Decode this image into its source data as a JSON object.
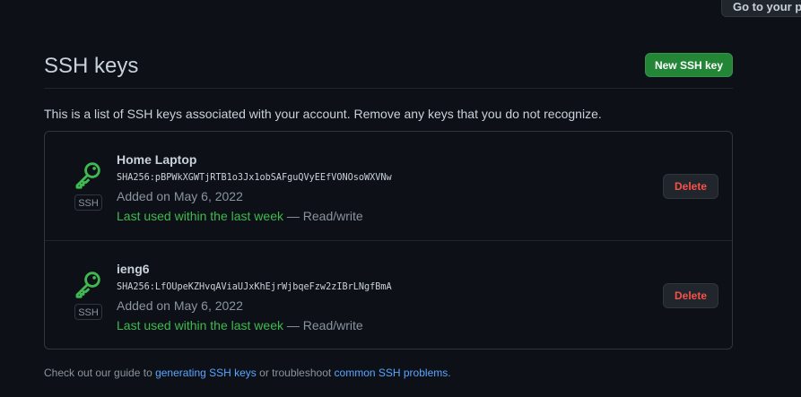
{
  "header": {
    "profile_button_label": "Go to your personal profile"
  },
  "page": {
    "title": "SSH keys",
    "new_key_button_label": "New SSH key",
    "intro": "This is a list of SSH keys associated with your account. Remove any keys that you do not recognize."
  },
  "keys": [
    {
      "name": "Home Laptop",
      "fingerprint": "SHA256:pBPWkXGWTjRTB1o3Jx1obSAFguQVyEEfVONOsoWXVNw",
      "added": "Added on May 6, 2022",
      "last_used": "Last used within the last week",
      "access": " — Read/write",
      "type_badge": "SSH",
      "delete_label": "Delete"
    },
    {
      "name": "ieng6",
      "fingerprint": "SHA256:LfOUpeKZHvqAViaUJxKhEjrWjbqeFzw2zIBrLNgfBmA",
      "added": "Added on May 6, 2022",
      "last_used": "Last used within the last week",
      "access": " — Read/write",
      "type_badge": "SSH",
      "delete_label": "Delete"
    }
  ],
  "footer": {
    "prefix": "Check out our guide to ",
    "link1": "generating SSH keys",
    "middle": " or troubleshoot ",
    "link2": "common SSH problems",
    "suffix": "."
  },
  "colors": {
    "background": "#0d1117",
    "primary_button": "#238636",
    "key_icon": "#3fb950",
    "danger": "#f85149",
    "link": "#58a6ff"
  },
  "icons": {
    "key": "key-icon"
  }
}
